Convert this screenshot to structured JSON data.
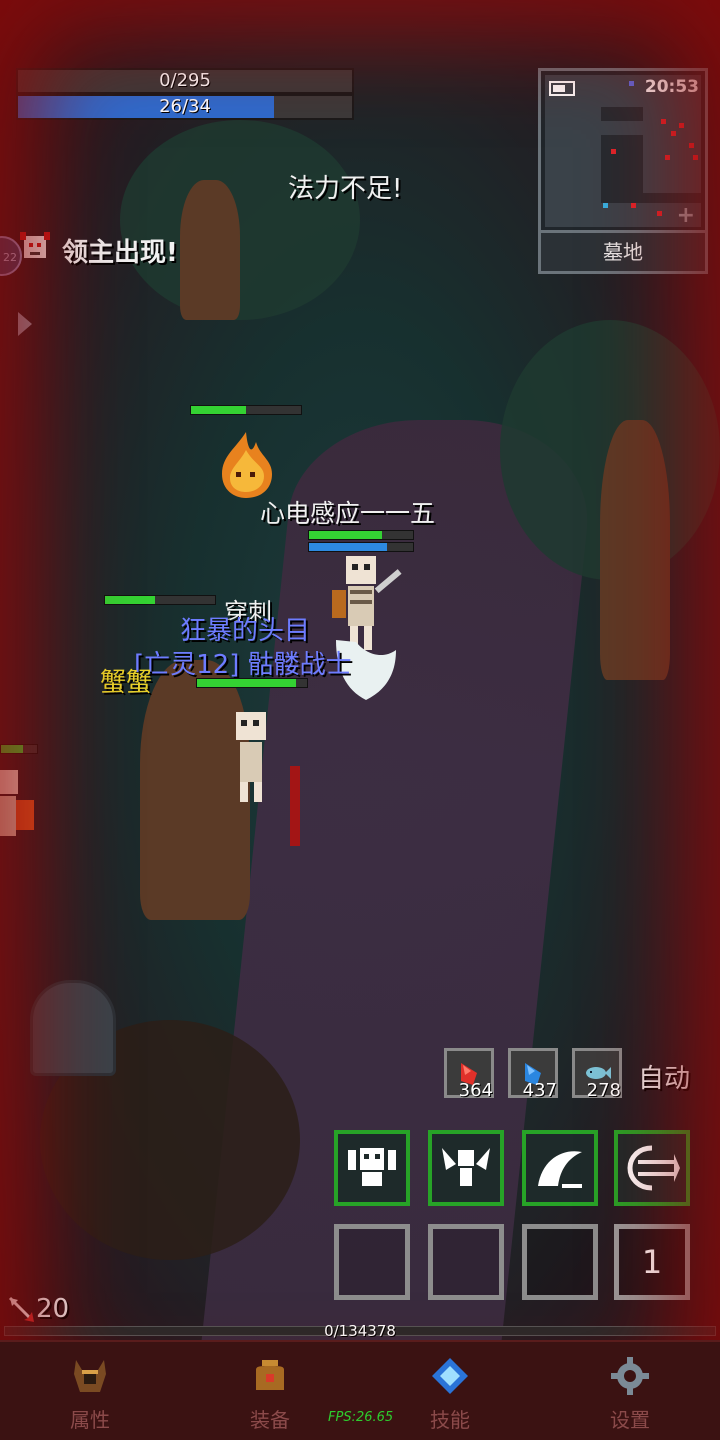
{
  "hud": {
    "hp_text": "0/295",
    "mp_text": "26/34",
    "mp_fraction": 0.765,
    "notice": "法力不足!",
    "boss_notice": "领主出现!",
    "level_badge": "22"
  },
  "minimap": {
    "time": "20:53",
    "location": "墓地"
  },
  "battle": {
    "texts": {
      "telepathy": "心电感应一一五",
      "pierce": "穿刺",
      "enemy_title": "狂暴的头目",
      "enemy_name": "[亡灵12] 骷髅战士",
      "ally_name": "蟹蟹"
    },
    "hp": {
      "flame": 0.5,
      "player": 0.7,
      "tree_enemy": 0.45,
      "skeleton": 0.9
    }
  },
  "consumables": [
    {
      "name": "red-potion",
      "count": "364",
      "color": "#e0302a"
    },
    {
      "name": "blue-potion",
      "count": "437",
      "color": "#2a86e0"
    },
    {
      "name": "fish",
      "count": "278",
      "color": "#7cc4d8"
    }
  ],
  "auto_label": "自动",
  "skill_slots": {
    "count_badge": "1"
  },
  "arrows": "20",
  "xp_text": "0/134378",
  "nav": [
    {
      "label": "属性",
      "icon": "helmet-icon"
    },
    {
      "label": "装备",
      "icon": "bag-icon"
    },
    {
      "label": "技能",
      "icon": "crystal-icon"
    },
    {
      "label": "设置",
      "icon": "gear-icon"
    }
  ],
  "fps": "FPS:26.65",
  "colors": {
    "accent_green": "#27a327",
    "mp_blue": "#2d6ccf",
    "nav_bg": "#3b1212",
    "enemy_name": "#6d7cff"
  }
}
